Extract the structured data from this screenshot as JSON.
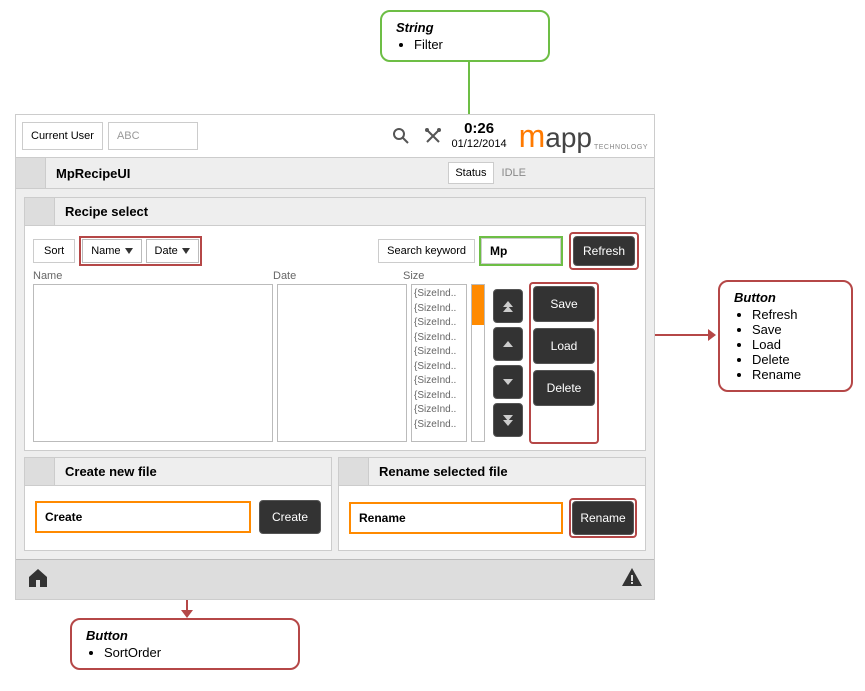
{
  "callouts": {
    "string": {
      "title": "String",
      "items": [
        "Filter"
      ]
    },
    "button": {
      "title": "Button",
      "items": [
        "Refresh",
        "Save",
        "Load",
        "Delete",
        "Rename"
      ]
    },
    "sortorder": {
      "title": "Button",
      "items": [
        "SortOrder"
      ]
    }
  },
  "header": {
    "user_label": "Current User",
    "user_value": "ABC",
    "time": "0:26",
    "date": "01/12/2014",
    "logo_m": "m",
    "logo_app": "app",
    "logo_tech": "TECHNOLOGY"
  },
  "subheader": {
    "title": "MpRecipeUI",
    "status_label": "Status",
    "status_value": "IDLE"
  },
  "recipe": {
    "title": "Recipe select",
    "sort_label": "Sort",
    "sort_name": "Name",
    "sort_date": "Date",
    "search_label": "Search keyword",
    "search_value": "Mp",
    "col_name": "Name",
    "col_date": "Date",
    "col_size": "Size",
    "size_items": [
      "{SizeInd..",
      "{SizeInd..",
      "{SizeInd..",
      "{SizeInd..",
      "{SizeInd..",
      "{SizeInd..",
      "{SizeInd..",
      "{SizeInd..",
      "{SizeInd..",
      "{SizeInd.."
    ],
    "btn_refresh": "Refresh",
    "btn_save": "Save",
    "btn_load": "Load",
    "btn_delete": "Delete"
  },
  "create": {
    "title": "Create new file",
    "input_value": "Create",
    "button": "Create"
  },
  "rename": {
    "title": "Rename selected file",
    "input_value": "Rename",
    "button": "Rename"
  }
}
